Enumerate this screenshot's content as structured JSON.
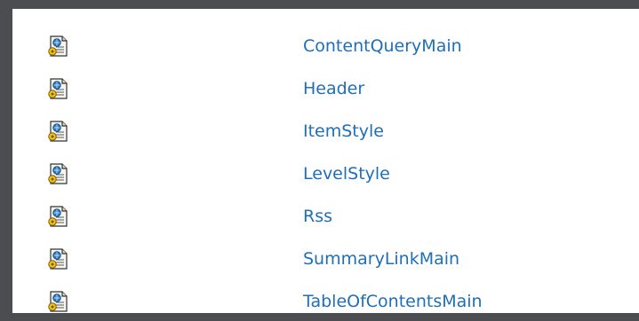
{
  "colors": {
    "background": "#4b4d50",
    "panel": "#ffffff",
    "link": "#1f6eb7"
  },
  "file_icon": "xsl-file-icon",
  "items": [
    {
      "name": "ContentQueryMain"
    },
    {
      "name": "Header"
    },
    {
      "name": "ItemStyle"
    },
    {
      "name": "LevelStyle"
    },
    {
      "name": "Rss"
    },
    {
      "name": "SummaryLinkMain"
    },
    {
      "name": "TableOfContentsMain"
    }
  ]
}
